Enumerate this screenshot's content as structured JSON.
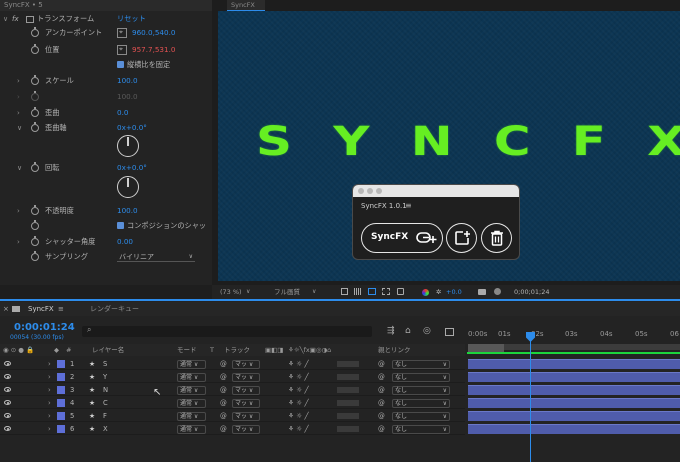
{
  "effect_controls": {
    "tab_title": "SyncFX • 5",
    "section": {
      "label": "トランスフォーム",
      "reset": "リセット"
    },
    "props": [
      {
        "label": "アンカーポイント",
        "value": "960.0,540.0"
      },
      {
        "label": "位置",
        "value": "957.7,531.0"
      },
      {
        "label": "縦横比を固定"
      },
      {
        "label": "スケール",
        "value": "100.0"
      },
      {
        "value": "100.0"
      },
      {
        "label": "歪曲",
        "value": "0.0"
      },
      {
        "label": "歪曲軸",
        "value": "0x+0.0°"
      },
      {
        "label": "回転",
        "value": "0x+0.0°"
      },
      {
        "label": "不透明度",
        "value": "100.0"
      },
      {
        "label": "コンポジションのシャッ"
      },
      {
        "label": "シャッター角度",
        "value": "0.00"
      },
      {
        "label": "サンプリング",
        "value": "バイリニア"
      }
    ]
  },
  "viewer": {
    "tab": "SyncFX",
    "logo_text": "SYNCFX",
    "zoom": "(73 %)",
    "resolution": "フル画質",
    "exposure": "+0.0",
    "timecode": "0;00;01;24"
  },
  "plugin": {
    "title": "SyncFX 1.0.1",
    "menu": "≡",
    "sync_button": "SyncFX"
  },
  "timeline": {
    "tab_comp": "SyncFX",
    "tab_render": "レンダーキュー",
    "current_time": "0:00:01:24",
    "fps_info": "00054 (30.00 fps)",
    "columns": {
      "layer_name": "レイヤー名",
      "mode": "モード",
      "track": "トラック",
      "parent": "親とリンク"
    },
    "ruler_labels": [
      "0:00s",
      "01s",
      "02s",
      "03s",
      "04s",
      "05s",
      "06"
    ],
    "layers": [
      {
        "num": "1",
        "name": "S",
        "mode": "通常",
        "matte": "マッ",
        "parent": "なし"
      },
      {
        "num": "2",
        "name": "Y",
        "mode": "通常",
        "matte": "マッ",
        "parent": "なし"
      },
      {
        "num": "3",
        "name": "N",
        "mode": "通常",
        "matte": "マッ",
        "parent": "なし"
      },
      {
        "num": "4",
        "name": "C",
        "mode": "通常",
        "matte": "マッ",
        "parent": "なし"
      },
      {
        "num": "5",
        "name": "F",
        "mode": "通常",
        "matte": "マッ",
        "parent": "なし"
      },
      {
        "num": "6",
        "name": "X",
        "mode": "通常",
        "matte": "マッ",
        "parent": "なし"
      }
    ]
  },
  "colors": {
    "accent_blue": "#2d8ceb",
    "logo_green": "#66ee22",
    "layer_label": "#5e6fd8",
    "warning_red": "#e35252"
  }
}
